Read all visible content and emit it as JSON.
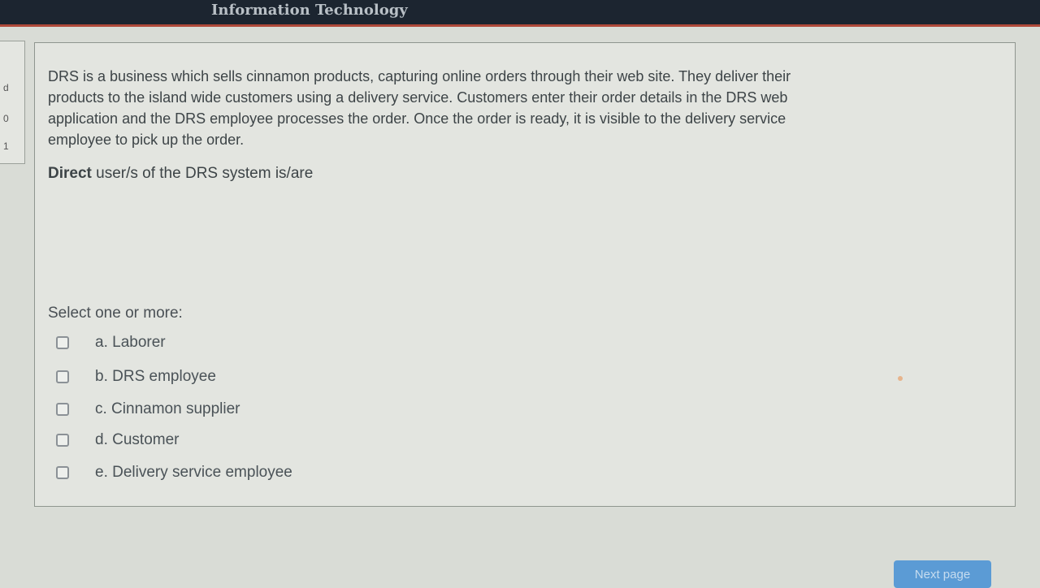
{
  "header": {
    "title_fragment": "Information Technology"
  },
  "left_tab": {
    "chars": [
      "d",
      "0",
      "1"
    ]
  },
  "question": {
    "text_lines": [
      "DRS is a business which sells cinnamon products, capturing online orders through their web site. They deliver their",
      "products to the island wide customers using a delivery service. Customers enter their order details in the DRS web",
      "application and the DRS employee processes the order. Once the order is ready, it is visible to the delivery service",
      "employee to pick up the order."
    ],
    "prompt_bold": "Direct",
    "prompt_rest": " user/s of the DRS system is/are",
    "select_label": "Select one or more:",
    "options": [
      {
        "label": "a. Laborer",
        "checked": false
      },
      {
        "label": "b. DRS employee",
        "checked": false
      },
      {
        "label": "c. Cinnamon supplier",
        "checked": false
      },
      {
        "label": "d. Customer",
        "checked": false
      },
      {
        "label": "e. Delivery service employee",
        "checked": false
      }
    ]
  },
  "navigation": {
    "next_label": "Next page"
  }
}
